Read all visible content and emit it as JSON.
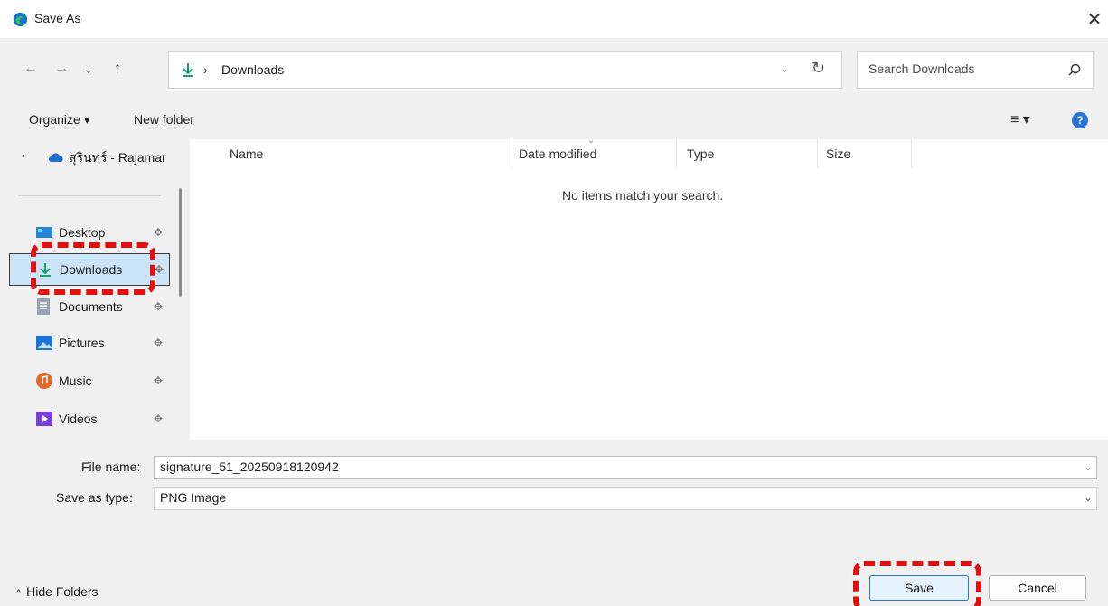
{
  "window": {
    "title": "Save As",
    "close_glyph": "✕"
  },
  "nav_buttons": {
    "back": "←",
    "forward": "→",
    "recent": "⌄",
    "up": "↑"
  },
  "address": {
    "separator": "›",
    "location": "Downloads"
  },
  "search": {
    "placeholder": "Search Downloads"
  },
  "toolbar": {
    "organize_label": "Organize ▾",
    "new_folder_label": "New folder",
    "view_label": "≡ ▾",
    "help_label": "?"
  },
  "sidebar": {
    "onedrive_label": "สุรินทร์ - Rajamar",
    "items": [
      {
        "label": "Desktop",
        "icon": "desktop-icon"
      },
      {
        "label": "Downloads",
        "icon": "download-icon",
        "selected": true
      },
      {
        "label": "Documents",
        "icon": "document-icon"
      },
      {
        "label": "Pictures",
        "icon": "pictures-icon"
      },
      {
        "label": "Music",
        "icon": "music-icon"
      },
      {
        "label": "Videos",
        "icon": "videos-icon"
      }
    ]
  },
  "columns": {
    "name": "Name",
    "date_modified": "Date modified",
    "type": "Type",
    "size": "Size"
  },
  "empty_message": "No items match your search.",
  "fields": {
    "file_name_label": "File name:",
    "file_name_value": "signature_51_20250918120942",
    "save_type_label": "Save as type:",
    "save_type_value": "PNG Image"
  },
  "footer": {
    "hide_folders_label": "Hide Folders",
    "save_label": "Save",
    "cancel_label": "Cancel"
  },
  "colors": {
    "accent": "#2b74c7",
    "selection": "#cce4f7",
    "annotation": "#e01010"
  }
}
